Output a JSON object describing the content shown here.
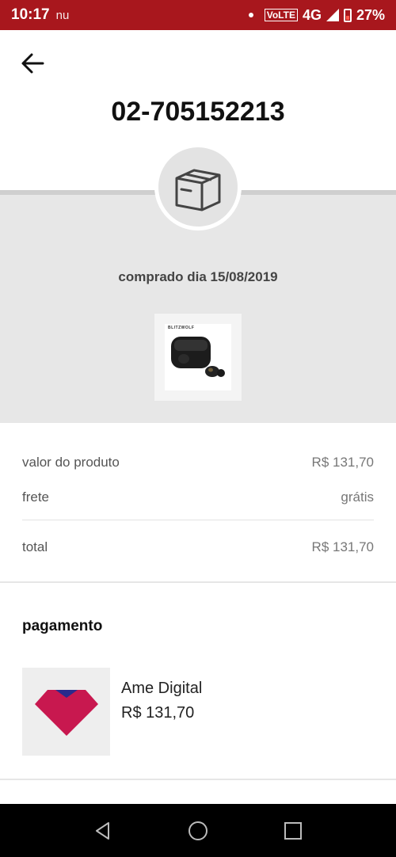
{
  "status_bar": {
    "time": "10:17",
    "carrier_icon": "nu",
    "network": "4G",
    "volte": "VoLTE",
    "battery": "27%"
  },
  "header": {
    "order_number": "02-705152213"
  },
  "order": {
    "purchase_date": "comprado dia 15/08/2019",
    "product_brand": "BLITZWOLF"
  },
  "summary": {
    "product_value_label": "valor do produto",
    "product_value": "R$ 131,70",
    "shipping_label": "frete",
    "shipping_value": "grátis",
    "total_label": "total",
    "total_value": "R$ 131,70"
  },
  "payment": {
    "title": "pagamento",
    "method_name": "Ame Digital",
    "amount": "R$ 131,70"
  },
  "colors": {
    "status_bar": "#a8171d",
    "ame_red": "#c8184f",
    "ame_blue": "#2a2a8c"
  }
}
